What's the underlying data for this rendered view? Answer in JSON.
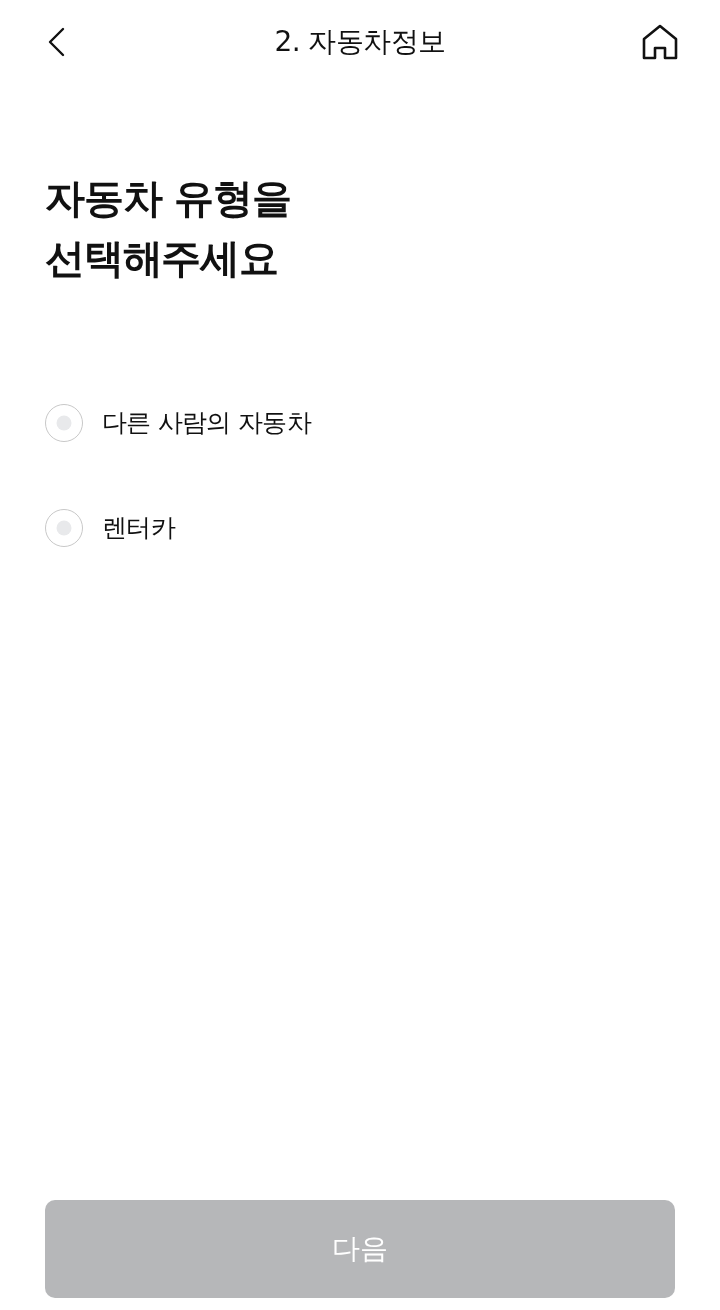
{
  "header": {
    "title": "2. 자동차정보"
  },
  "heading": "자동차 유형을\n선택해주세요",
  "options": [
    {
      "label": "다른 사람의 자동차",
      "selected": false
    },
    {
      "label": "렌터카",
      "selected": false
    }
  ],
  "next_button": {
    "label": "다음",
    "disabled": true
  }
}
